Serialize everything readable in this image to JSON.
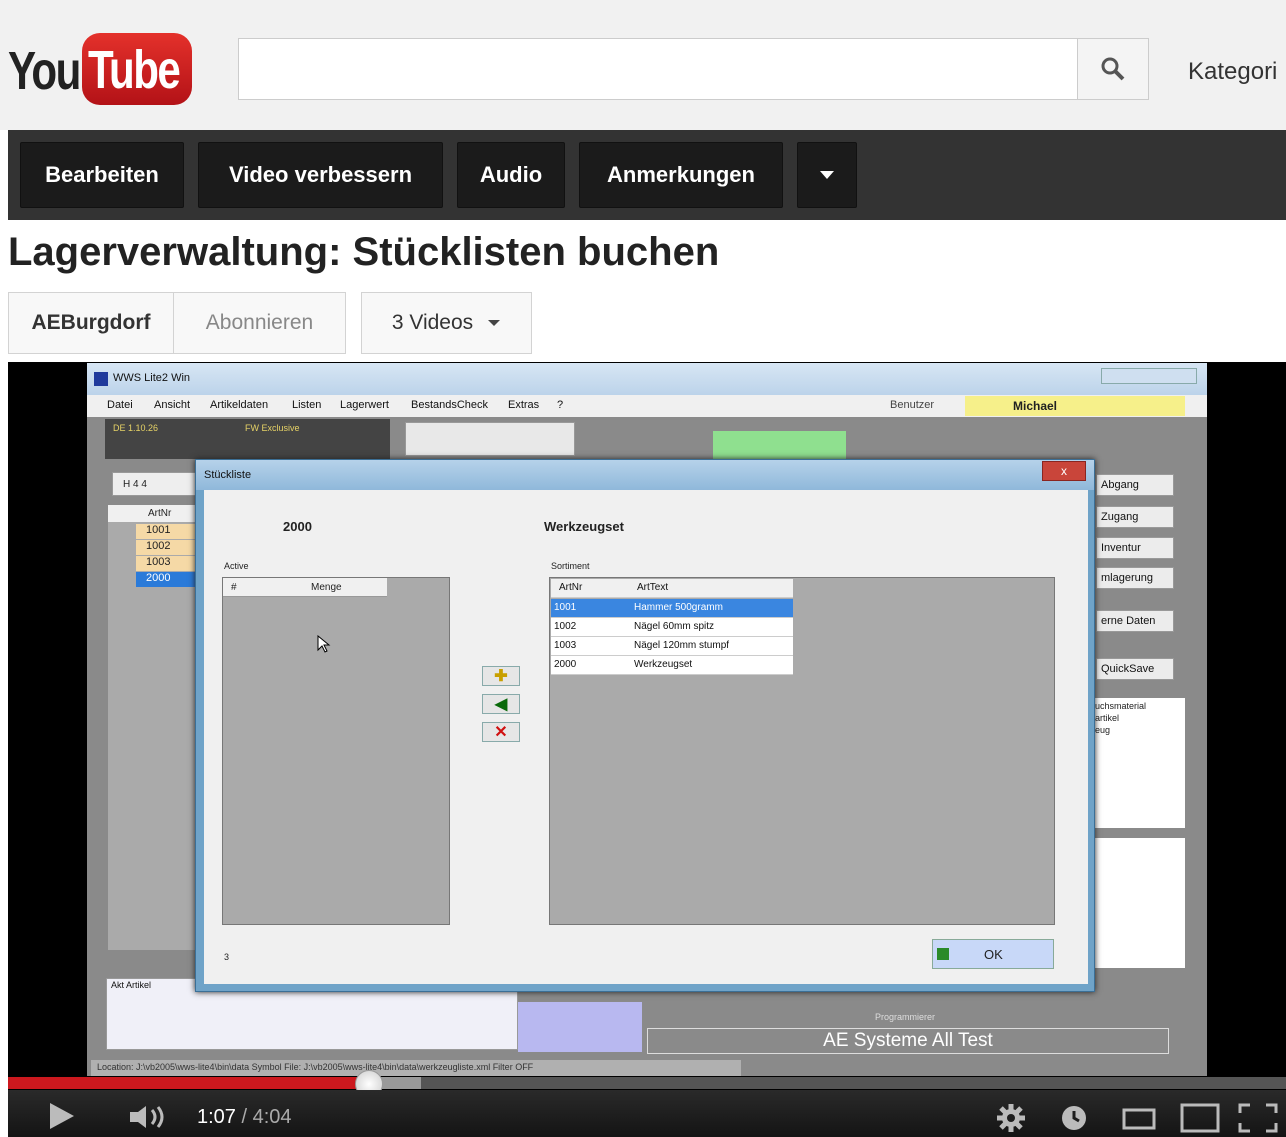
{
  "header": {
    "logo_you": "You",
    "logo_tube": "Tube",
    "search_placeholder": "",
    "category_label": "Kategori"
  },
  "editor_nav": {
    "buttons": [
      "Bearbeiten",
      "Video verbessern",
      "Audio",
      "Anmerkungen"
    ]
  },
  "video": {
    "title": "Lagerverwaltung: Stücklisten buchen",
    "channel": "AEBurgdorf",
    "subscribe": "Abonnieren",
    "videos_count": "3 Videos"
  },
  "app": {
    "window_title": "WWS Lite2 Win",
    "menu": [
      "Datei",
      "Ansicht",
      "Artikeldaten",
      "Listen",
      "Lagerwert",
      "BestandsCheck",
      "Extras",
      "?"
    ],
    "user_label": "Benutzer",
    "user_name": "Michael",
    "status_left": "DE 1.10.26",
    "status_mid": "FW Exclusive",
    "nav_text": "H 4 4",
    "grid_header": "ArtNr",
    "grid_rows": [
      "1001",
      "1002",
      "1003",
      "2000"
    ],
    "side_buttons": [
      "Abgang",
      "Zugang",
      "Inventur",
      "mlagerung",
      "erne Daten",
      "QuickSave"
    ],
    "side_list": [
      "uchsmaterial",
      "artikel",
      "eug"
    ],
    "akt_artikel_label": "Akt Artikel",
    "program_label": "Programmierer",
    "brand_box": "AE Systeme All Test",
    "statusbar": "Location: J:\\vb2005\\wws-lite4\\bin\\data   Symbol   File: J:\\vb2005\\wws-lite4\\bin\\data\\werkzeugliste.xml   Filter OFF"
  },
  "dialog": {
    "title": "Stückliste",
    "article_nr": "2000",
    "article_name": "Werkzeugset",
    "left_label": "Active",
    "left_headers": [
      "#",
      "Menge"
    ],
    "right_label": "Sortiment",
    "right_headers": [
      "ArtNr",
      "ArtText"
    ],
    "rows": [
      {
        "nr": "1001",
        "text": "Hammer 500gramm"
      },
      {
        "nr": "1002",
        "text": "Nägel 60mm spitz"
      },
      {
        "nr": "1003",
        "text": "Nägel 120mm stumpf"
      },
      {
        "nr": "2000",
        "text": "Werkzeugset"
      }
    ],
    "footer_count": "3",
    "ok_label": "OK"
  },
  "player": {
    "time_current": "1:07",
    "time_total": "/ 4:04",
    "played_fraction": 0.28,
    "loaded_fraction": 0.32
  }
}
